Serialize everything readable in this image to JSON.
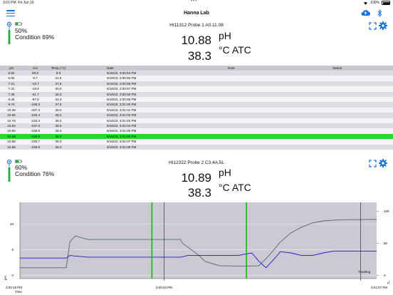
{
  "status_bar": {
    "time": "3:01 PM",
    "date": "Fri Jun 16",
    "battery": "100%"
  },
  "nav": {
    "title": "Hanna Lab"
  },
  "colors": {
    "accent": "#1a73d9",
    "highlight": "#1fe01f",
    "marker": "#11bb11",
    "series_ph": "#4a6a6a",
    "series_temp": "#1a1ad0",
    "plot_bg": "#cdc9d2"
  },
  "probes": [
    {
      "battery_pct": "50%",
      "condition": "Condition 69%",
      "name": "HI11312 Probe 1 A0.11.08",
      "value1": "10.88",
      "unit1": "pH",
      "value2": "38.3",
      "unit2": "°C ATC"
    },
    {
      "battery_pct": "60%",
      "condition": "Condition 76%",
      "name": "HI12322 Probe 2 C3.4A.5L",
      "value1": "10.89",
      "unit1": "pH",
      "value2": "38.3",
      "unit2": "°C ATC"
    }
  ],
  "table": {
    "headers": [
      "pH",
      "mV",
      "Temp (°C)",
      "Date",
      "Note",
      "Status"
    ],
    "rows": [
      [
        "5.92",
        "80.8",
        "9.9",
        "6/16/23, 3:00:54 PM",
        "",
        ""
      ],
      [
        "6.85",
        "9.7",
        "21.5",
        "6/16/23, 3:00:55 PM",
        "",
        ""
      ],
      [
        "7.21",
        "-12.7",
        "37.8",
        "6/16/23, 3:00:56 PM",
        "",
        ""
      ],
      [
        "7.31",
        "-18.9",
        "30.0",
        "6/16/23, 3:00:57 PM",
        "",
        ""
      ],
      [
        "7.36",
        "-21.7",
        "28.3",
        "6/16/23, 3:00:58 PM",
        "",
        ""
      ],
      [
        "8.45",
        "-87.8",
        "32.4",
        "6/16/23, 3:00:59 PM",
        "",
        ""
      ],
      [
        "9.74",
        "-169.3",
        "37.9",
        "6/16/23, 3:01:00 PM",
        "",
        ""
      ],
      [
        "10.36",
        "-207.3",
        "38.0",
        "6/16/23, 3:01:01 PM",
        "",
        ""
      ],
      [
        "10.65",
        "-225.4",
        "38.2",
        "6/16/23, 3:01:02 PM",
        "",
        ""
      ],
      [
        "10.78",
        "-233.3",
        "38.2",
        "6/16/23, 3:01:03 PM",
        "",
        ""
      ],
      [
        "10.84",
        "-237.0",
        "38.3",
        "6/16/23, 3:01:04 PM",
        "",
        ""
      ],
      [
        "10.86",
        "-238.8",
        "38.3",
        "6/16/23, 3:01:05 PM",
        "",
        ""
      ],
      [
        "10.88",
        "-239.0",
        "38.3",
        "6/16/23, 3:01:06 PM",
        "",
        ""
      ],
      [
        "10.88",
        "-239.7",
        "38.3",
        "6/16/23, 3:01:07 PM",
        "",
        ""
      ],
      [
        "10.88",
        "-239.9",
        "38.3",
        "6/16/23, 3:01:08 PM",
        "",
        ""
      ]
    ],
    "selected_index": 12
  },
  "chart_data": {
    "type": "line",
    "y_left": {
      "label": "pH",
      "ticks": [
        0,
        5,
        10
      ],
      "range": [
        -0.6,
        14.2
      ]
    },
    "y_right": {
      "label": "°C",
      "ticks": [
        0,
        50,
        100
      ],
      "range": [
        -5,
        114
      ]
    },
    "x_ticks": [
      "3:00:19 PM",
      "3:00:43 PM",
      "3:01:07 PM"
    ],
    "x_label": "Time",
    "mode_label": "Tracking",
    "series": [
      {
        "axis": "left",
        "color": "#4a6a6a",
        "x": [
          0,
          0.13,
          0.14,
          0.155,
          0.19,
          0.45,
          0.455,
          0.5,
          0.52,
          0.56,
          0.63,
          0.67,
          0.7,
          0.73,
          0.76,
          0.79,
          0.82,
          0.85,
          0.88,
          0.92,
          0.96,
          1.0
        ],
        "y": [
          1.5,
          1.5,
          6.5,
          7.7,
          7.0,
          7.0,
          6.3,
          4.0,
          2.7,
          1.9,
          1.8,
          1.9,
          4.0,
          6.5,
          8.3,
          9.4,
          10.2,
          10.6,
          10.75,
          10.84,
          10.87,
          10.88
        ]
      },
      {
        "axis": "right",
        "color": "#1a1ad0",
        "x": [
          0,
          0.13,
          0.14,
          0.19,
          0.45,
          0.47,
          0.61,
          0.62,
          0.65,
          0.67,
          0.69,
          0.72,
          0.73,
          0.76,
          0.79,
          0.82,
          0.85,
          0.88,
          1.0
        ],
        "y": [
          27,
          27,
          31,
          28.5,
          28.5,
          31,
          31,
          32,
          35,
          22,
          12,
          30,
          37,
          35,
          31,
          31,
          35,
          38,
          38
        ]
      }
    ],
    "markers": [
      0.37,
      0.635
    ],
    "cursor": 0.404,
    "right_cursor": 0.955
  }
}
